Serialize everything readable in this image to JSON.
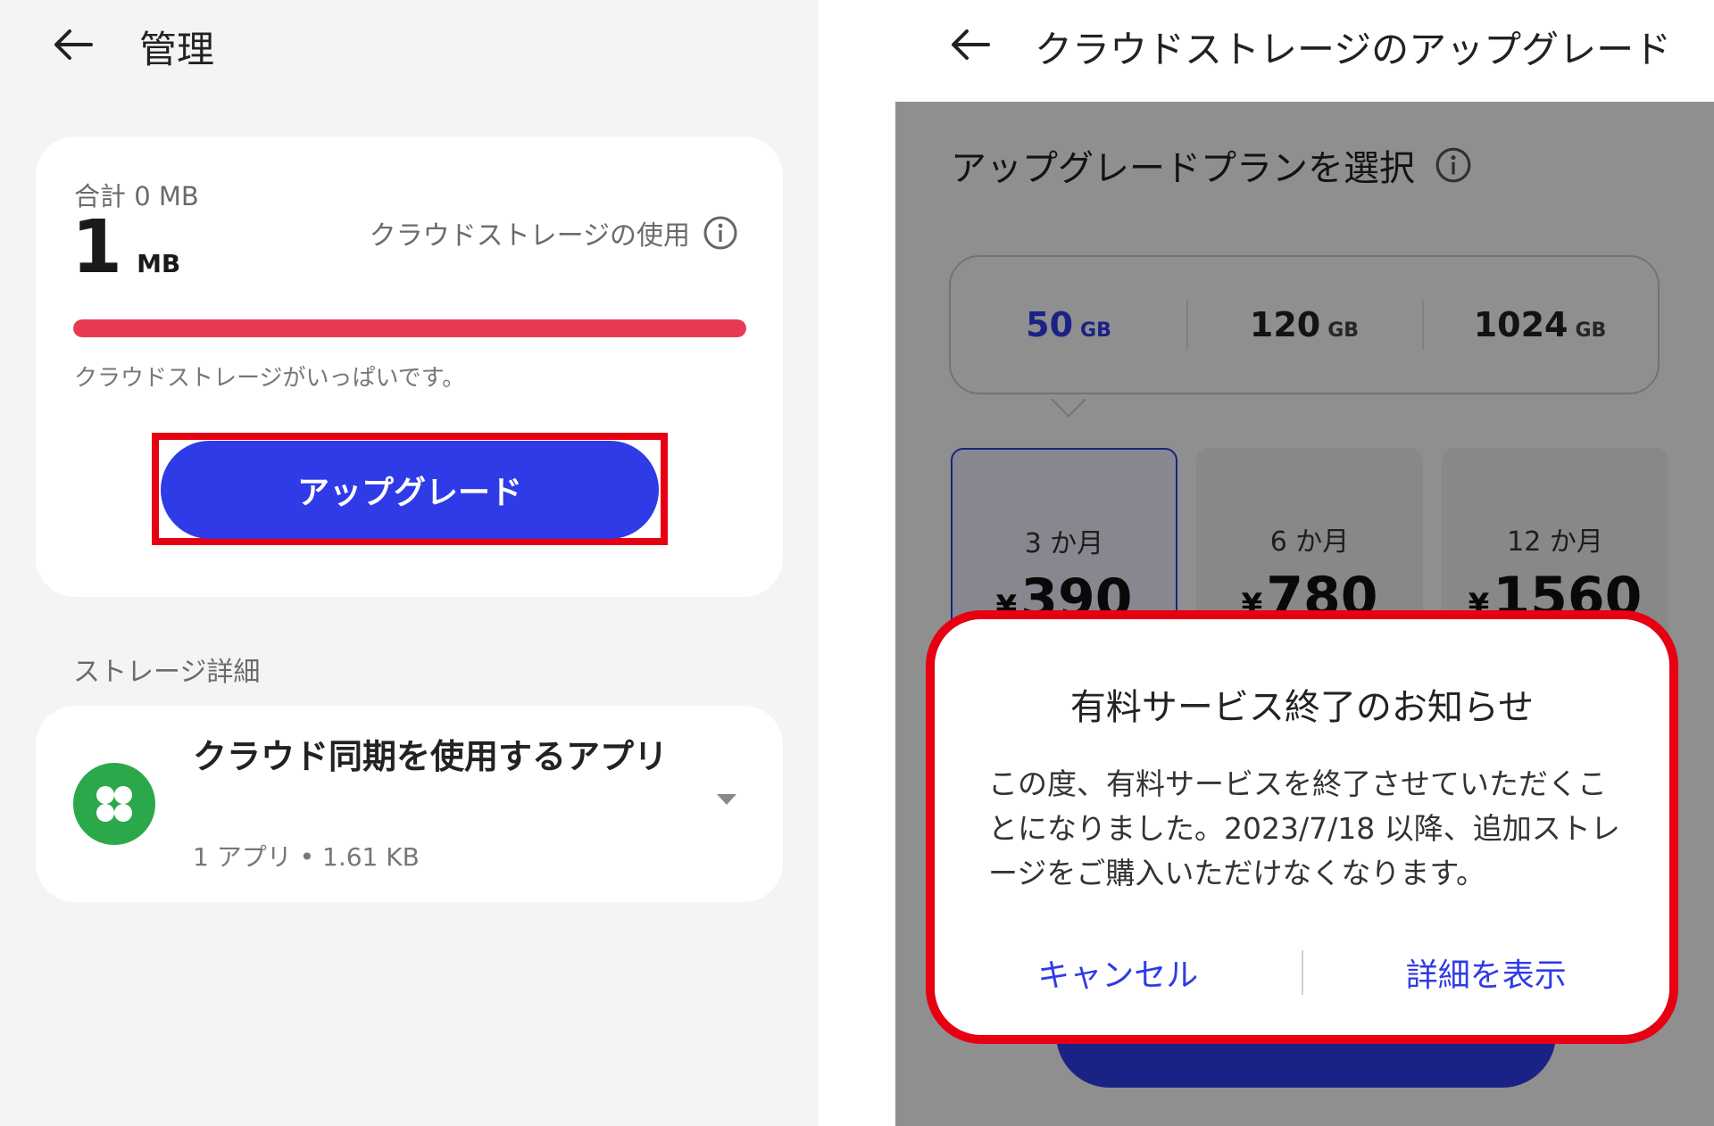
{
  "left": {
    "header": {
      "title": "管理"
    },
    "usage": {
      "total_label": "合計 0 MB",
      "used_number": "1",
      "used_unit": "MB",
      "title": "クラウドストレージの使用",
      "progress_fraction": 1.0,
      "progress_color": "#e83b53",
      "full_message": "クラウドストレージがいっぱいです。",
      "upgrade_label": "アップグレード"
    },
    "storage_section_label": "ストレージ詳細",
    "apps": {
      "title": "クラウド同期を使用するアプリ",
      "subtitle": "1 アプリ • 1.61 KB",
      "icon": "clover-app-icon"
    }
  },
  "right": {
    "header": {
      "title": "クラウドストレージのアップグレード"
    },
    "plan_heading": "アップグレードプランを選択",
    "capacity_tabs": [
      {
        "value": "50",
        "unit": "GB",
        "active": true
      },
      {
        "value": "120",
        "unit": "GB",
        "active": false
      },
      {
        "value": "1024",
        "unit": "GB",
        "active": false
      }
    ],
    "periods": [
      {
        "label": "3 か月",
        "currency": "¥",
        "price": "390",
        "active": true
      },
      {
        "label": "6 か月",
        "currency": "¥",
        "price": "780",
        "active": false
      },
      {
        "label": "12 か月",
        "currency": "¥",
        "price": "1560",
        "active": false
      }
    ],
    "dialog": {
      "title": "有料サービス終了のお知らせ",
      "body": "この度、有料サービスを終了させていただくことになりました。2023/7/18 以降、追加ストレージをご購入いただけなくなります。",
      "cancel_label": "キャンセル",
      "details_label": "詳細を表示"
    }
  },
  "colors": {
    "accent": "#2f3be6",
    "highlight": "#e60012",
    "app_icon": "#2ba84a"
  }
}
